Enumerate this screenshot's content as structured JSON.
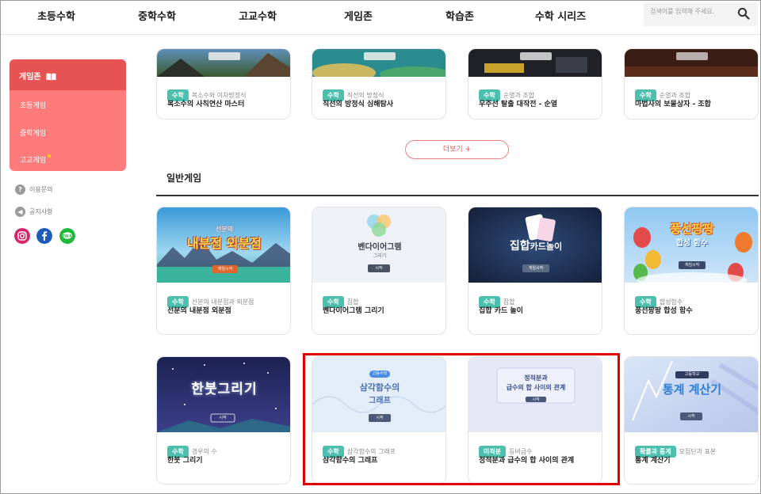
{
  "nav": {
    "items": [
      "초등수학",
      "중학수학",
      "고교수학",
      "게임존",
      "학습존",
      "수학 시리즈"
    ],
    "search_placeholder": "검색어를 입력해 주세요."
  },
  "sidebar": {
    "title": "게임존",
    "items": [
      "초등게임",
      "중학게임",
      "고교게임"
    ],
    "links": [
      "이용문의",
      "공지사항"
    ],
    "social": [
      "instagram-icon",
      "facebook-icon",
      "kakaotalk-icon"
    ]
  },
  "top_games": [
    {
      "tag": "수학",
      "topic": "복소수와 이차방정식",
      "title": "복소수의 사칙연산 마스터",
      "thumb_label": "게임시작"
    },
    {
      "tag": "수학",
      "topic": "직선의 방정식",
      "title": "직선의 방정식 심해탐사",
      "thumb_label": "게임시작"
    },
    {
      "tag": "수학",
      "topic": "순열과 조합",
      "title": "우주선 탈출 대작전 - 순열",
      "thumb_label": "게임시작"
    },
    {
      "tag": "수학",
      "topic": "순열과 조합",
      "title": "마법사의 보물상자 - 조합",
      "thumb_label": "게임시작"
    }
  ],
  "more_button": "더보기 +",
  "section_title": "일반게임",
  "general_games": [
    {
      "tag": "수학",
      "topic": "선분의 내분점과 외분점",
      "title": "선분의 내분점 외분점",
      "thumb_title": "내분점 외분점",
      "thumb_sub": "선분의",
      "thumb_btn": "게임시작"
    },
    {
      "tag": "수학",
      "topic": "집합",
      "title": "벤다이어그램 그리기",
      "thumb_title": "벤다이어그램",
      "thumb_sub": "그리기",
      "thumb_btn": "시작"
    },
    {
      "tag": "수학",
      "topic": "집합",
      "title": "집합 카드 놀이",
      "thumb_title": "집합",
      "thumb_sub": "카드놀이",
      "thumb_btn": "게임시작"
    },
    {
      "tag": "수학",
      "topic": "합성함수",
      "title": "풍선팡팡 합성 함수",
      "thumb_title": "풍선팡팡",
      "thumb_sub": "합성 함수",
      "thumb_btn": "게임시작"
    },
    {
      "tag": "수학",
      "topic": "경우의 수",
      "title": "한붓 그리기",
      "thumb_title": "한붓그리기",
      "thumb_sub": "",
      "thumb_btn": "시작"
    },
    {
      "tag": "수학",
      "topic": "삼각함수의 그래프",
      "title": "삼각함수의 그래프",
      "thumb_title": "삼각함수의",
      "thumb_sub": "그래프",
      "thumb_badge": "고등수학",
      "thumb_btn": "시작"
    },
    {
      "tag": "미적분",
      "topic": "등비급수",
      "title": "정적분과 급수의 합 사이의 관계",
      "thumb_title": "정적분과",
      "thumb_sub": "급수의 합 사이의 관계",
      "thumb_btn": "시작"
    },
    {
      "tag": "확률과 통계",
      "topic": "모집단과 표본",
      "title": "통계 계산기",
      "thumb_title": "통계 계산기",
      "thumb_badge": "고등학교",
      "thumb_sub": "",
      "thumb_btn": "시작"
    }
  ],
  "colors": {
    "accent_red": "#e75353",
    "sidebar_pink": "#fe7b7b",
    "tag_teal": "#4cbfae",
    "highlight": "#e00000"
  }
}
